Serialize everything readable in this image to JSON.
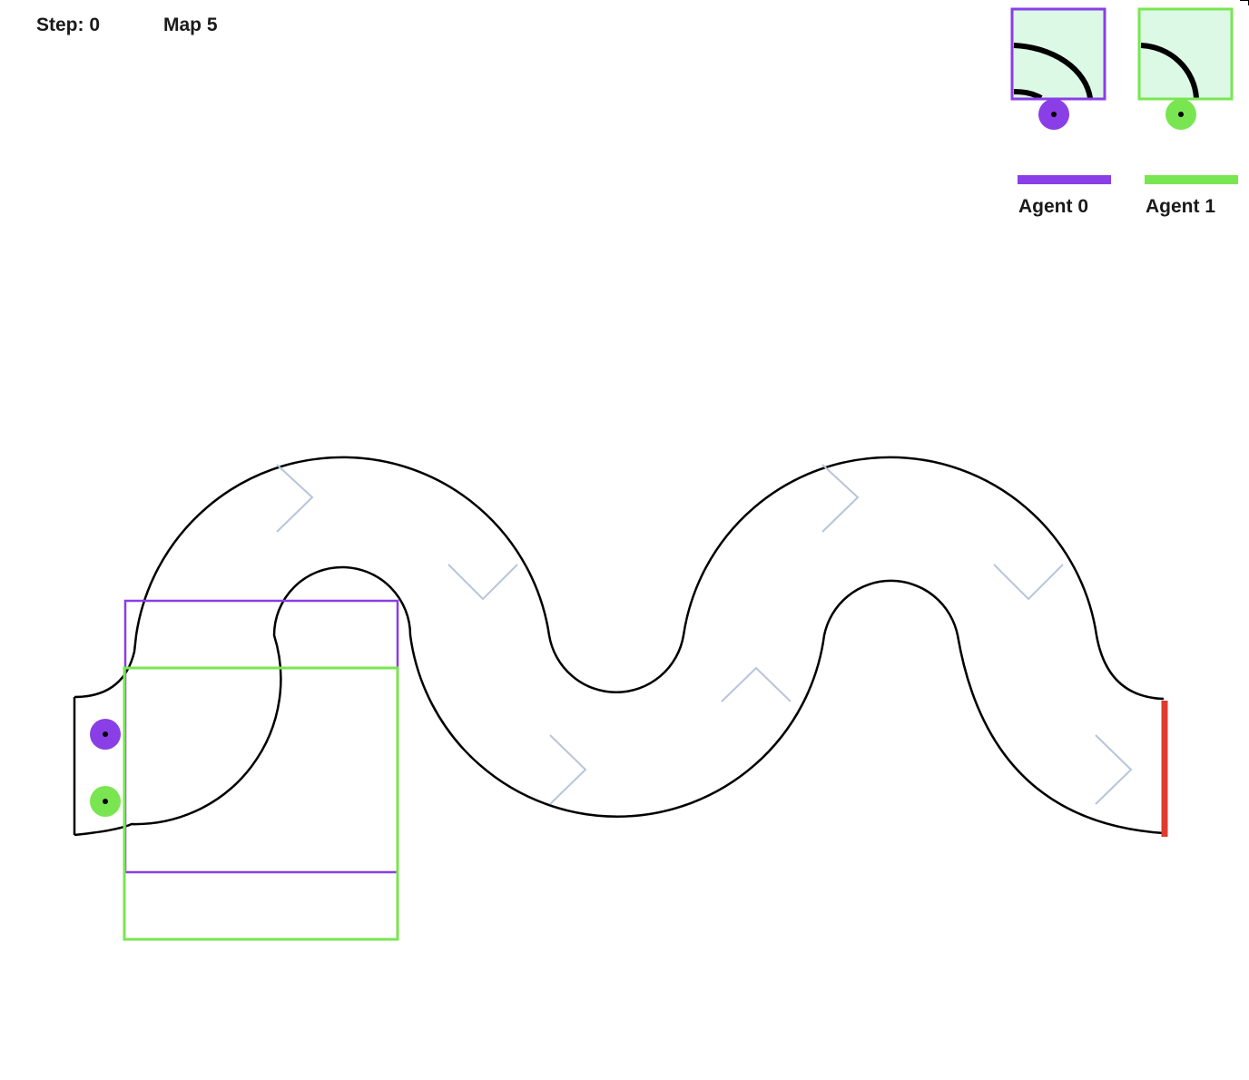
{
  "hud": {
    "step_label": "Step: 0",
    "map_label": "Map 5"
  },
  "agents": [
    {
      "name": "Agent 0",
      "color": "#8a3ee6",
      "icon": "agent-marker"
    },
    {
      "name": "Agent 1",
      "color": "#79e651",
      "icon": "agent-marker"
    }
  ],
  "track": {
    "wall_color": "#000000",
    "finish_line_color": "#e03a2f",
    "direction_arrow_color": "#b8c4dc",
    "view_fill_color": "#dcf9e6"
  }
}
